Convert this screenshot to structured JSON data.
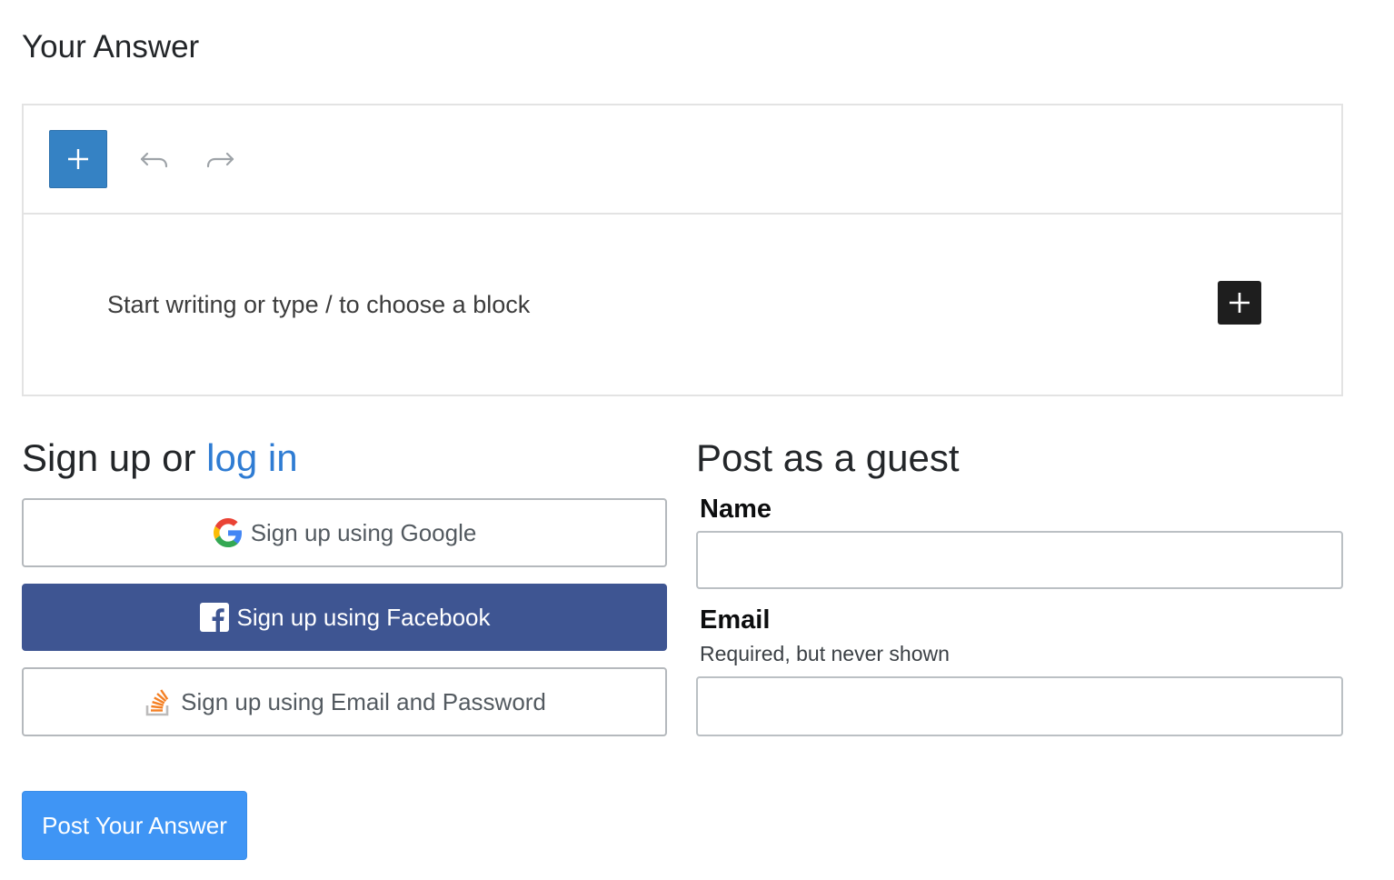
{
  "page": {
    "title": "Your Answer"
  },
  "editor": {
    "placeholder": "Start writing or type / to choose a block",
    "icons": {
      "inserter": "plus-icon",
      "undo": "undo-icon",
      "redo": "redo-icon",
      "block_add": "plus-icon"
    },
    "colors": {
      "inserter_bg": "#3582c4",
      "block_add_bg": "#1e1e1e"
    }
  },
  "signup": {
    "title_prefix": "Sign up or ",
    "login_link": "log in",
    "google_label": "Sign up using Google",
    "facebook_label": "Sign up using Facebook",
    "email_label": "Sign up using Email and Password",
    "colors": {
      "link": "#2f7cd3",
      "facebook_bg": "#3e5592"
    }
  },
  "guest": {
    "title": "Post as a guest",
    "name_label": "Name",
    "name_value": "",
    "email_label": "Email",
    "email_desc": "Required, but never shown",
    "email_value": ""
  },
  "submit": {
    "label": "Post Your Answer",
    "color": "#3f95f5"
  }
}
